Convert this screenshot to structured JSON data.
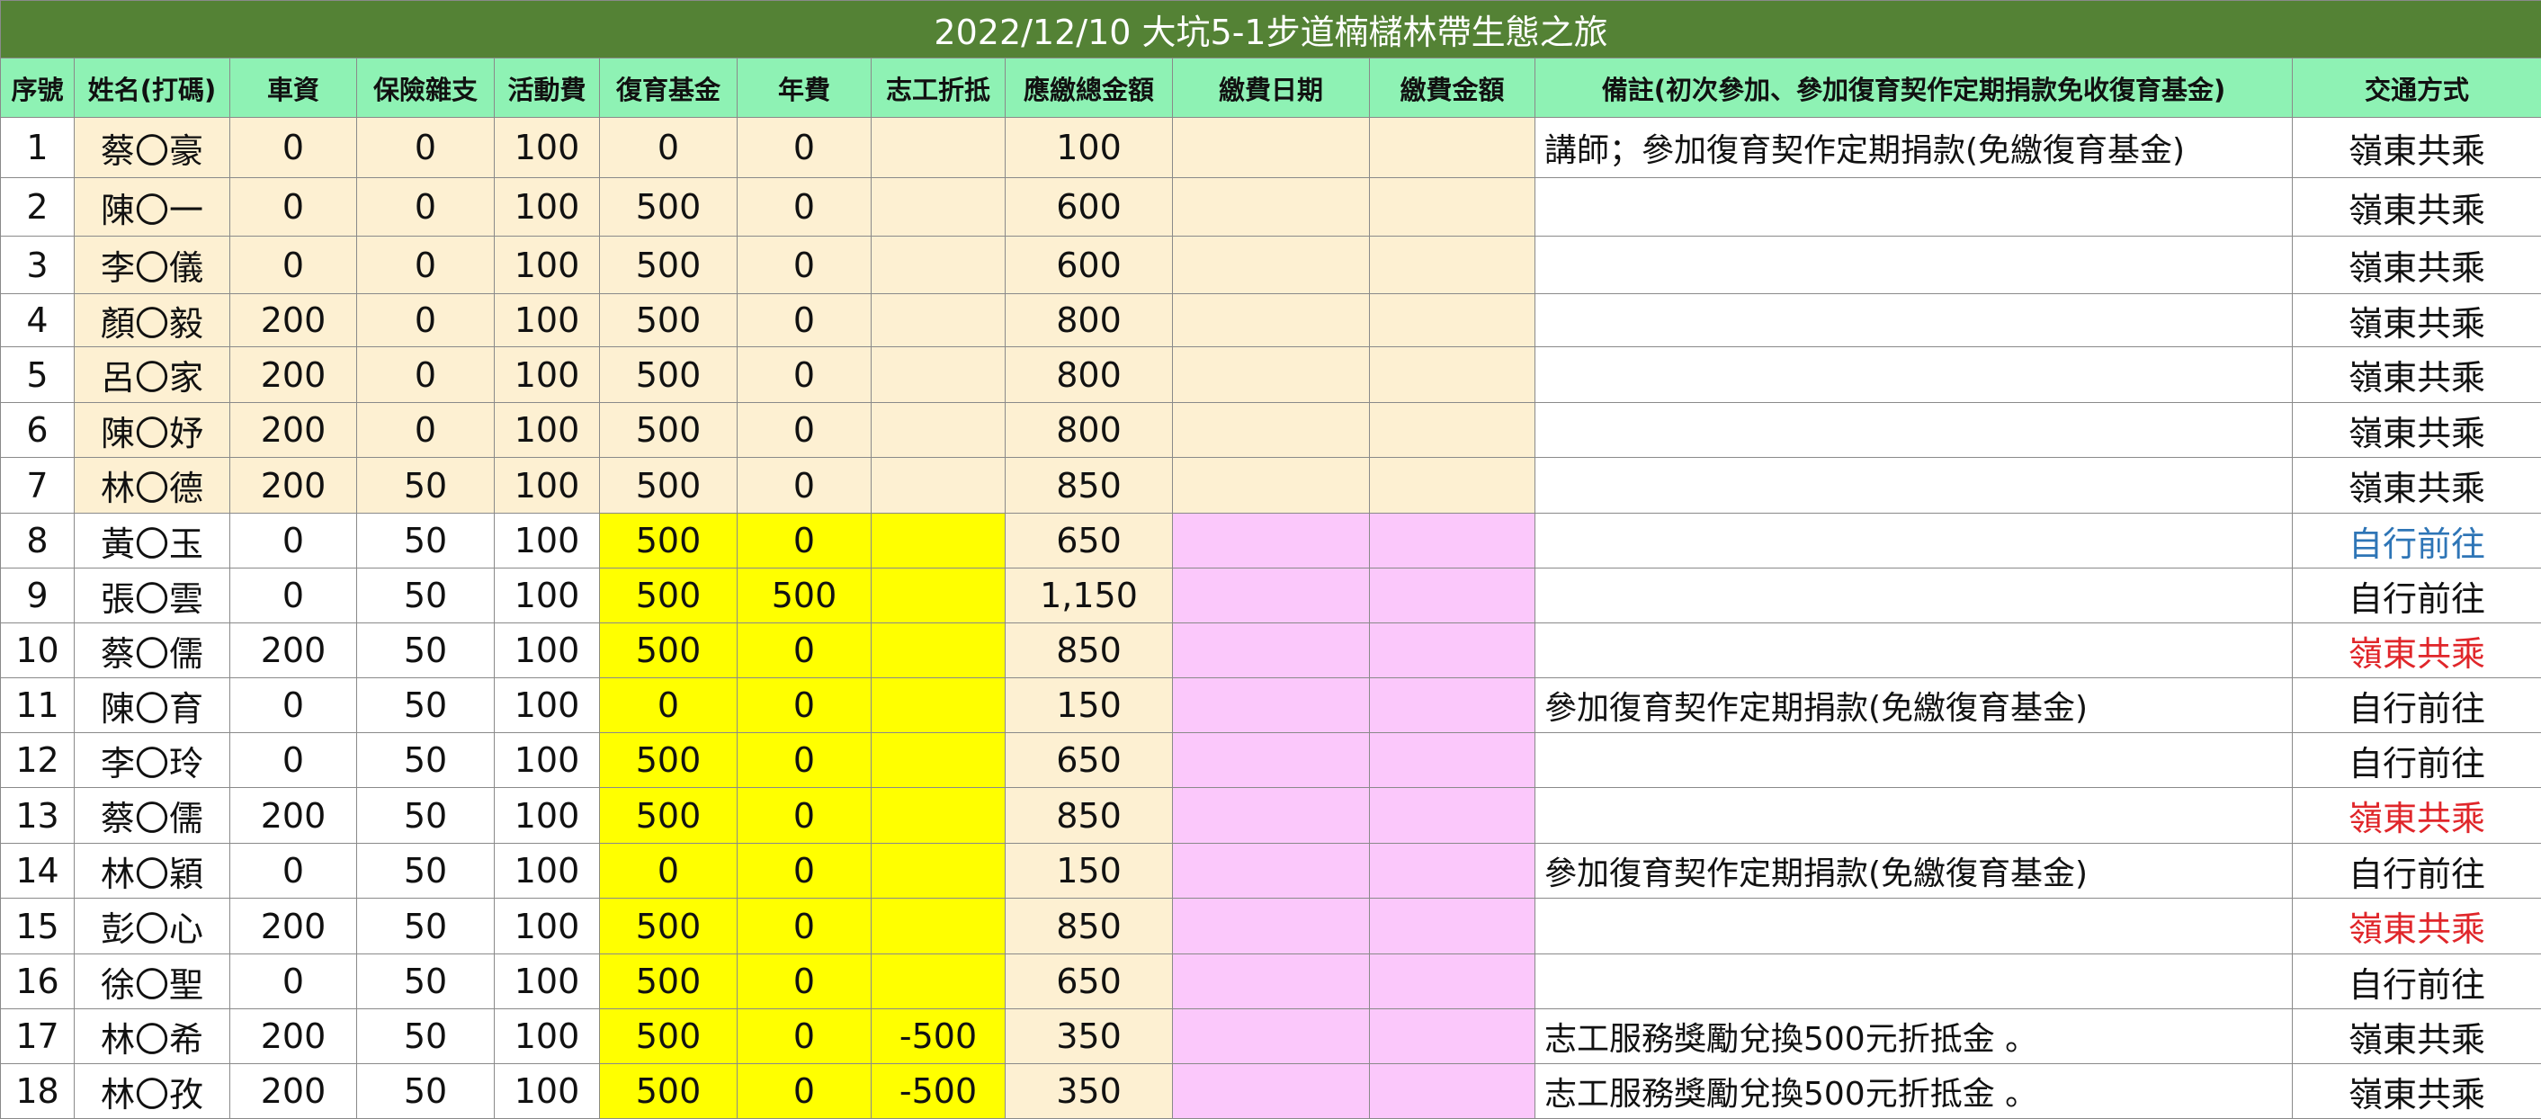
{
  "title": "2022/12/10 大坑5-1步道楠櫧林帶生態之旅",
  "headers": [
    "序號",
    "姓名(打碼)",
    "車資",
    "保險雜支",
    "活動費",
    "復育基金",
    "年費",
    "志工折抵",
    "應繳總金額",
    "繳費日期",
    "繳費金額",
    "備註(初次參加、參加復育契作定期捐款免收復育基金)",
    "交通方式"
  ],
  "colors": {
    "title_bg": "#548235",
    "header_bg": "#8ef2b4",
    "peach": "#fdf0d2",
    "yellow": "#ffff00",
    "pink": "#fbc8fb",
    "blue_text": "#2e75b6",
    "red_text": "#e0262a"
  },
  "rows": [
    {
      "no": "1",
      "name": "蔡〇豪",
      "fare": "0",
      "insurance": "0",
      "activity": "100",
      "fund": "0",
      "annual": "0",
      "volunteer": "",
      "total": "100",
      "date": "",
      "paid": "",
      "remark": "講師；參加復育契作定期捐款(免繳復育基金)",
      "transport": "嶺東共乘"
    },
    {
      "no": "2",
      "name": "陳〇一",
      "fare": "0",
      "insurance": "0",
      "activity": "100",
      "fund": "500",
      "annual": "0",
      "volunteer": "",
      "total": "600",
      "date": "",
      "paid": "",
      "remark": "",
      "transport": "嶺東共乘"
    },
    {
      "no": "3",
      "name": "李〇儀",
      "fare": "0",
      "insurance": "0",
      "activity": "100",
      "fund": "500",
      "annual": "0",
      "volunteer": "",
      "total": "600",
      "date": "",
      "paid": "",
      "remark": "",
      "transport": "嶺東共乘"
    },
    {
      "no": "4",
      "name": "顏〇毅",
      "fare": "200",
      "insurance": "0",
      "activity": "100",
      "fund": "500",
      "annual": "0",
      "volunteer": "",
      "total": "800",
      "date": "",
      "paid": "",
      "remark": "",
      "transport": "嶺東共乘"
    },
    {
      "no": "5",
      "name": "呂〇家",
      "fare": "200",
      "insurance": "0",
      "activity": "100",
      "fund": "500",
      "annual": "0",
      "volunteer": "",
      "total": "800",
      "date": "",
      "paid": "",
      "remark": "",
      "transport": "嶺東共乘"
    },
    {
      "no": "6",
      "name": "陳〇妤",
      "fare": "200",
      "insurance": "0",
      "activity": "100",
      "fund": "500",
      "annual": "0",
      "volunteer": "",
      "total": "800",
      "date": "",
      "paid": "",
      "remark": "",
      "transport": "嶺東共乘"
    },
    {
      "no": "7",
      "name": "林〇德",
      "fare": "200",
      "insurance": "50",
      "activity": "100",
      "fund": "500",
      "annual": "0",
      "volunteer": "",
      "total": "850",
      "date": "",
      "paid": "",
      "remark": "",
      "transport": "嶺東共乘"
    },
    {
      "no": "8",
      "name": "黃〇玉",
      "fare": "0",
      "insurance": "50",
      "activity": "100",
      "fund": "500",
      "annual": "0",
      "volunteer": "",
      "total": "650",
      "date": "",
      "paid": "",
      "remark": "",
      "transport": "自行前往"
    },
    {
      "no": "9",
      "name": "張〇雲",
      "fare": "0",
      "insurance": "50",
      "activity": "100",
      "fund": "500",
      "annual": "500",
      "volunteer": "",
      "total": "1,150",
      "date": "",
      "paid": "",
      "remark": "",
      "transport": "自行前往"
    },
    {
      "no": "10",
      "name": "蔡〇儒",
      "fare": "200",
      "insurance": "50",
      "activity": "100",
      "fund": "500",
      "annual": "0",
      "volunteer": "",
      "total": "850",
      "date": "",
      "paid": "",
      "remark": "",
      "transport": "嶺東共乘"
    },
    {
      "no": "11",
      "name": "陳〇育",
      "fare": "0",
      "insurance": "50",
      "activity": "100",
      "fund": "0",
      "annual": "0",
      "volunteer": "",
      "total": "150",
      "date": "",
      "paid": "",
      "remark": "參加復育契作定期捐款(免繳復育基金)",
      "transport": "自行前往"
    },
    {
      "no": "12",
      "name": "李〇玲",
      "fare": "0",
      "insurance": "50",
      "activity": "100",
      "fund": "500",
      "annual": "0",
      "volunteer": "",
      "total": "650",
      "date": "",
      "paid": "",
      "remark": "",
      "transport": "自行前往"
    },
    {
      "no": "13",
      "name": "蔡〇儒",
      "fare": "200",
      "insurance": "50",
      "activity": "100",
      "fund": "500",
      "annual": "0",
      "volunteer": "",
      "total": "850",
      "date": "",
      "paid": "",
      "remark": "",
      "transport": "嶺東共乘"
    },
    {
      "no": "14",
      "name": "林〇穎",
      "fare": "0",
      "insurance": "50",
      "activity": "100",
      "fund": "0",
      "annual": "0",
      "volunteer": "",
      "total": "150",
      "date": "",
      "paid": "",
      "remark": "參加復育契作定期捐款(免繳復育基金)",
      "transport": "自行前往"
    },
    {
      "no": "15",
      "name": "彭〇心",
      "fare": "200",
      "insurance": "50",
      "activity": "100",
      "fund": "500",
      "annual": "0",
      "volunteer": "",
      "total": "850",
      "date": "",
      "paid": "",
      "remark": "",
      "transport": "嶺東共乘"
    },
    {
      "no": "16",
      "name": "徐〇聖",
      "fare": "0",
      "insurance": "50",
      "activity": "100",
      "fund": "500",
      "annual": "0",
      "volunteer": "",
      "total": "650",
      "date": "",
      "paid": "",
      "remark": "",
      "transport": "自行前往"
    },
    {
      "no": "17",
      "name": "林〇希",
      "fare": "200",
      "insurance": "50",
      "activity": "100",
      "fund": "500",
      "annual": "0",
      "volunteer": "-500",
      "total": "350",
      "date": "",
      "paid": "",
      "remark": "志工服務獎勵兌換500元折抵金 。",
      "transport": "嶺東共乘"
    },
    {
      "no": "18",
      "name": "林〇孜",
      "fare": "200",
      "insurance": "50",
      "activity": "100",
      "fund": "500",
      "annual": "0",
      "volunteer": "-500",
      "total": "350",
      "date": "",
      "paid": "",
      "remark": "志工服務獎勵兌換500元折抵金 。",
      "transport": "嶺東共乘"
    }
  ]
}
